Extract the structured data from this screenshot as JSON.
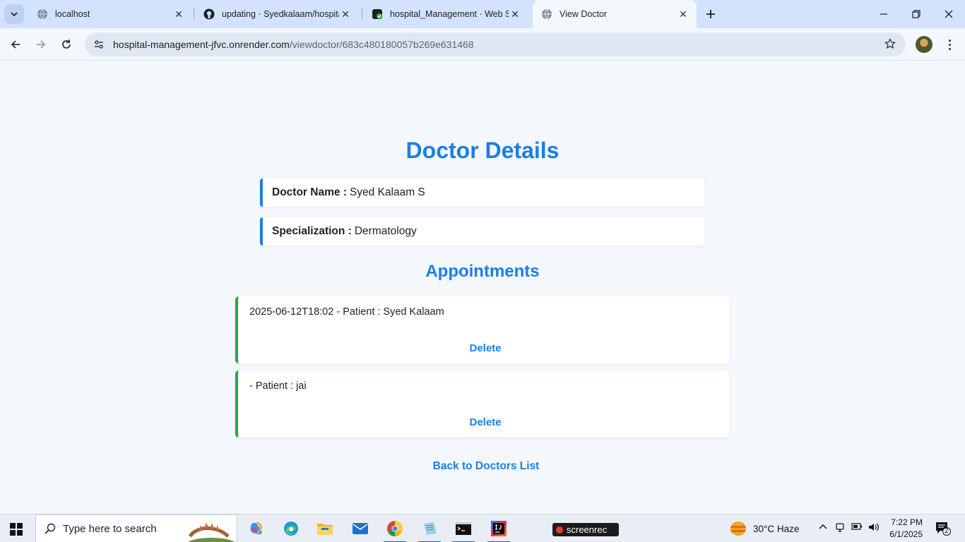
{
  "browser": {
    "tabs": [
      {
        "title": "localhost",
        "active": false
      },
      {
        "title": "updating · Syedkalaam/hospital",
        "active": false
      },
      {
        "title": "hospital_Management · Web Se",
        "active": false
      },
      {
        "title": "View Doctor",
        "active": true
      }
    ],
    "url_host": "hospital-management-jfvc.onrender.com",
    "url_path": "/viewdoctor/683c480180057b269e631468"
  },
  "page": {
    "title": "Doctor Details",
    "doctor_name_label": "Doctor Name :",
    "doctor_name": "Syed Kalaam S",
    "specialization_label": "Specialization :",
    "specialization": "Dermatology",
    "appointments_title": "Appointments",
    "appointments": [
      {
        "text": "2025-06-12T18:02 - Patient : Syed Kalaam",
        "action": "Delete"
      },
      {
        "text": "- Patient : jai",
        "action": "Delete"
      }
    ],
    "back_link": "Back to Doctors List"
  },
  "taskbar": {
    "search_placeholder": "Type here to search",
    "screenrec_label": "screenrec",
    "weather": "30°C  Haze",
    "time": "7:22 PM",
    "date": "6/1/2025",
    "notification_count": "2"
  },
  "colors": {
    "accent_blue": "#1a7fe6",
    "appointment_border": "#28a745"
  }
}
